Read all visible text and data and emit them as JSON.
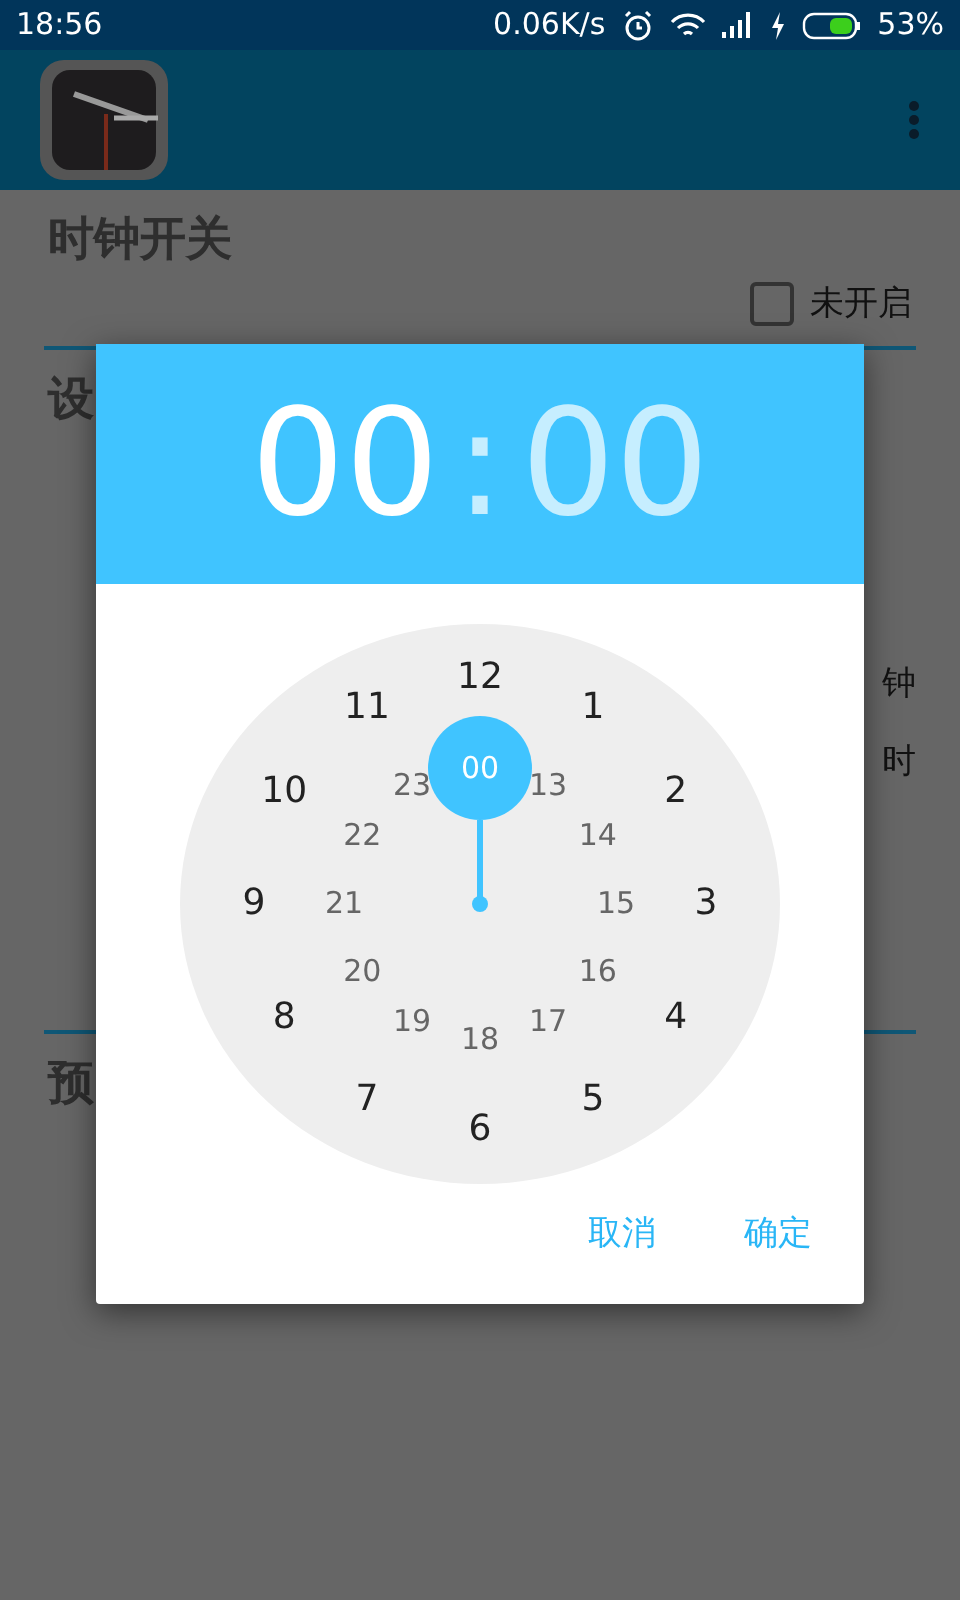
{
  "status_bar": {
    "time": "18:56",
    "net_speed": "0.06K/s",
    "battery": "53%"
  },
  "background": {
    "title": "时钟开关",
    "checkbox": {
      "label": "未开启",
      "checked": false
    },
    "section_fragment": "设",
    "section_fragment_2": "预",
    "right_fragments": [
      "钟",
      "时"
    ]
  },
  "dialog": {
    "time_parts": [
      {
        "text": "00",
        "selected": true
      },
      {
        "text": ":",
        "selected": false
      },
      {
        "text": "00",
        "selected": false
      }
    ],
    "outer_numbers": [
      {
        "label": "12",
        "selected": false
      },
      {
        "label": "1",
        "selected": false
      },
      {
        "label": "2",
        "selected": false
      },
      {
        "label": "3",
        "selected": false
      },
      {
        "label": "4",
        "selected": false
      },
      {
        "label": "5",
        "selected": false
      },
      {
        "label": "6",
        "selected": false
      },
      {
        "label": "7",
        "selected": false
      },
      {
        "label": "8",
        "selected": false
      },
      {
        "label": "9",
        "selected": false
      },
      {
        "label": "10",
        "selected": false
      },
      {
        "label": "11",
        "selected": false
      }
    ],
    "inner_numbers": [
      {
        "label": "00",
        "selected": true
      },
      {
        "label": "13",
        "selected": false
      },
      {
        "label": "14",
        "selected": false
      },
      {
        "label": "15",
        "selected": false
      },
      {
        "label": "16",
        "selected": false
      },
      {
        "label": "17",
        "selected": false
      },
      {
        "label": "18",
        "selected": false
      },
      {
        "label": "19",
        "selected": false
      },
      {
        "label": "20",
        "selected": false
      },
      {
        "label": "21",
        "selected": false
      },
      {
        "label": "22",
        "selected": false
      },
      {
        "label": "23",
        "selected": false
      }
    ],
    "buttons": [
      "取消",
      "确定"
    ]
  }
}
